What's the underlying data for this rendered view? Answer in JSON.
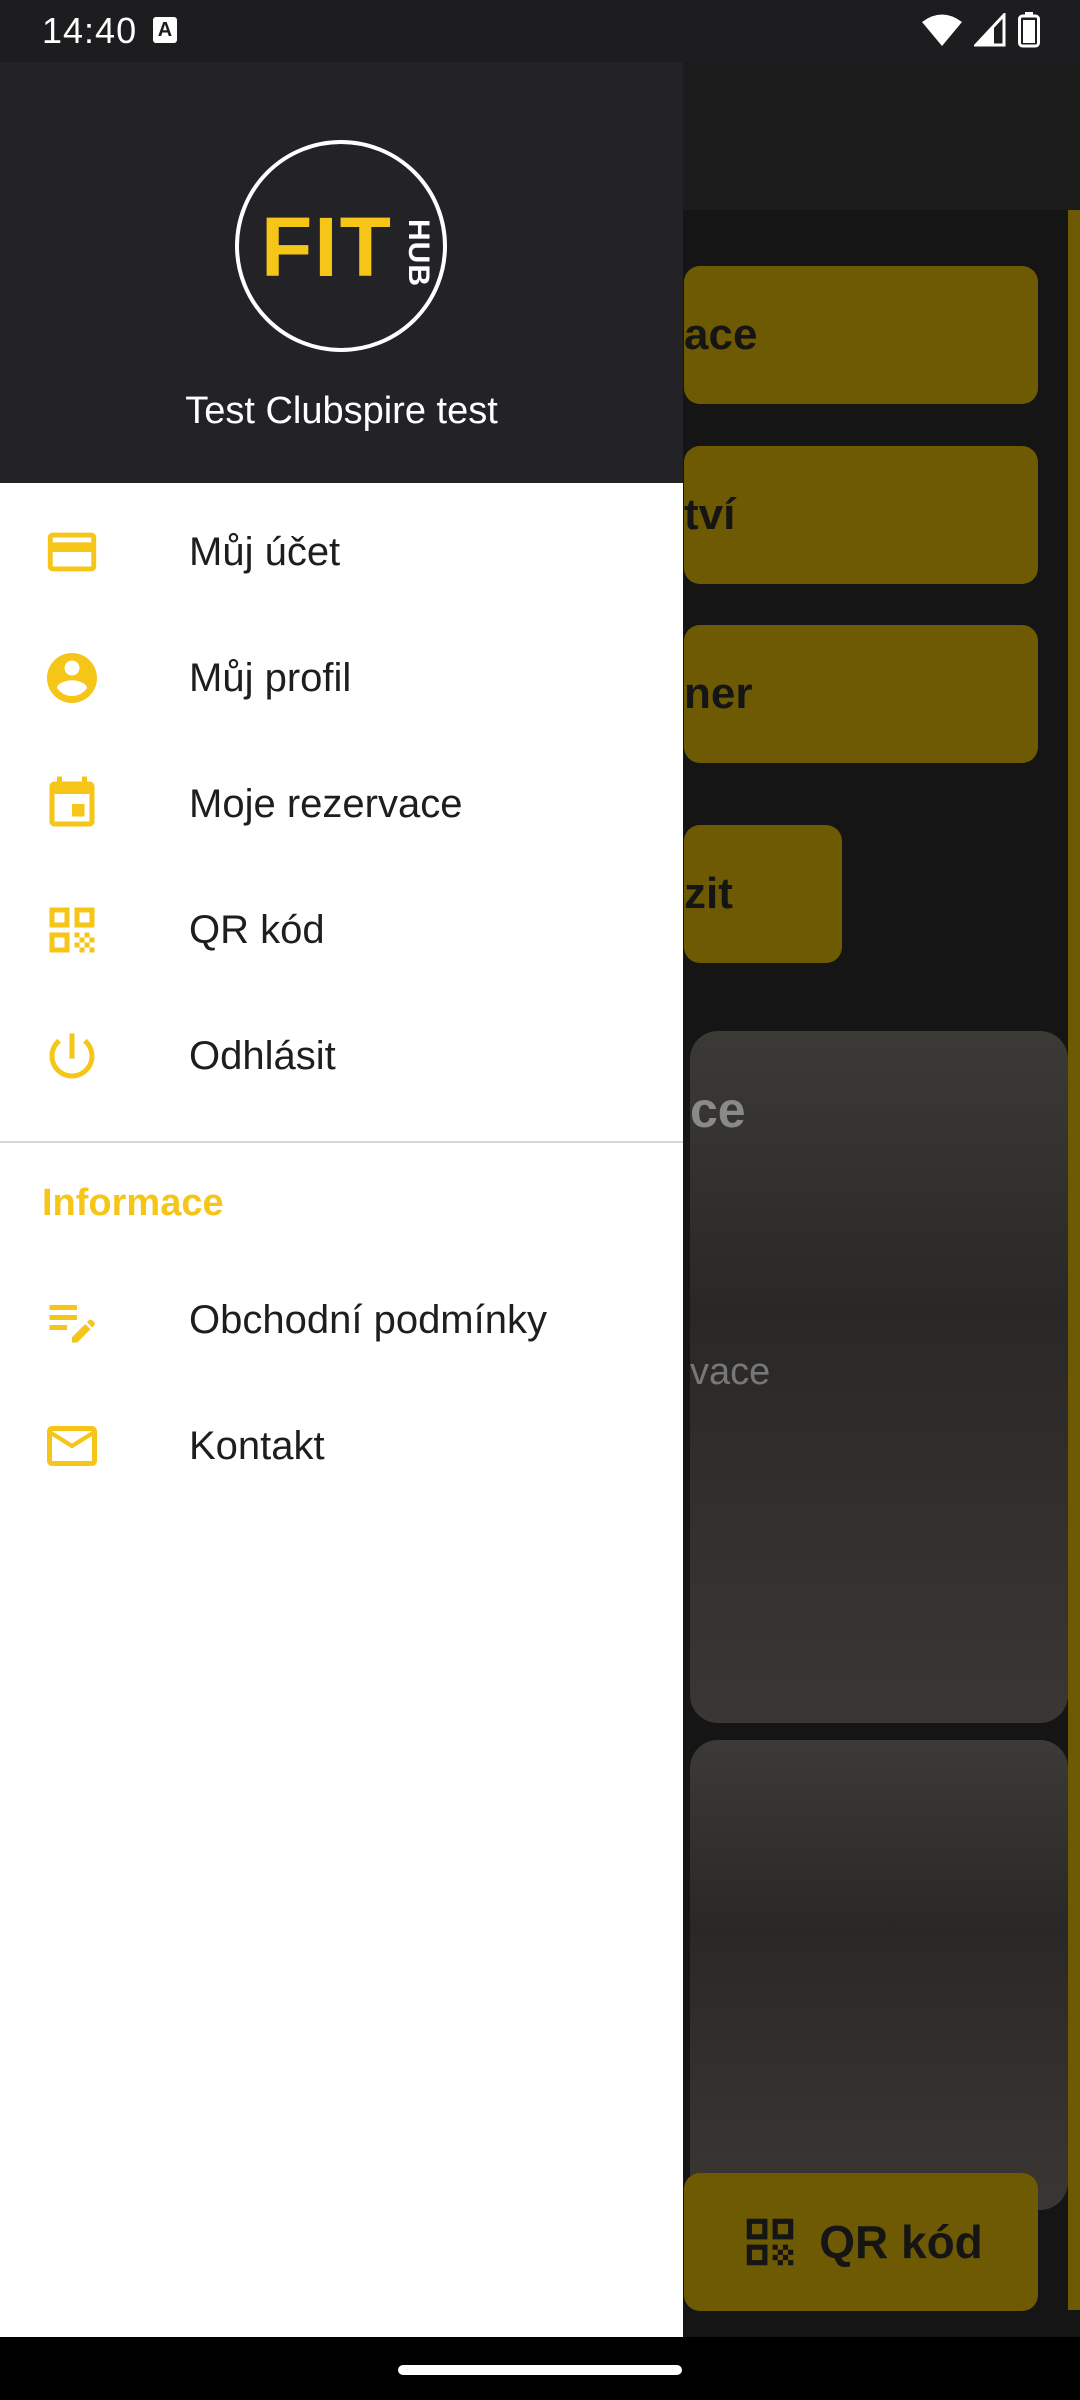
{
  "status_bar": {
    "time": "14:40",
    "notification_icon": "a-letter-icon"
  },
  "background": {
    "buttons": [
      "ace",
      "tví",
      "ner",
      "zit"
    ],
    "card": {
      "title": "ce",
      "subtitle": "vace"
    },
    "qr_button_label": "QR kód"
  },
  "drawer": {
    "logo_text": "FIT",
    "logo_sub": "HUB",
    "user_name": "Test Clubspire test",
    "items": [
      {
        "label": "Můj účet",
        "icon": "credit-card-icon"
      },
      {
        "label": "Můj profil",
        "icon": "account-circle-icon"
      },
      {
        "label": "Moje rezervace",
        "icon": "calendar-icon"
      },
      {
        "label": "QR kód",
        "icon": "qr-code-icon"
      },
      {
        "label": "Odhlásit",
        "icon": "power-icon"
      }
    ],
    "section_title": "Informace",
    "info_items": [
      {
        "label": "Obchodní podmínky",
        "icon": "edit-note-icon"
      },
      {
        "label": "Kontakt",
        "icon": "mail-icon"
      }
    ]
  },
  "colors": {
    "accent": "#f5c518",
    "drawer_header": "#232327"
  }
}
